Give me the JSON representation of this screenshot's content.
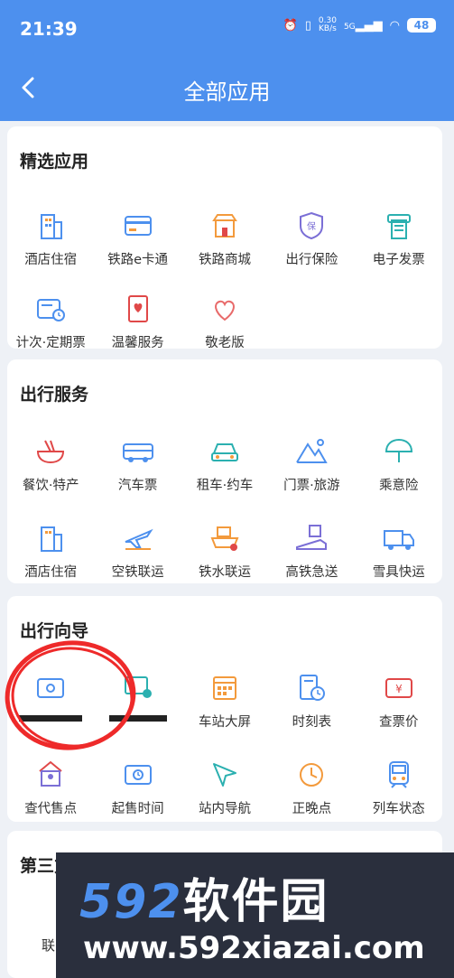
{
  "status": {
    "time": "21:39",
    "speed_top": "0.30",
    "speed_unit": "KB/s",
    "net": "5G",
    "battery": "48"
  },
  "nav": {
    "title": "全部应用"
  },
  "sections": [
    {
      "title": "精选应用",
      "items": [
        "酒店住宿",
        "铁路e卡通",
        "铁路商城",
        "出行保险",
        "电子发票",
        "计次·定期票",
        "温馨服务",
        "敬老版"
      ]
    },
    {
      "title": "出行服务",
      "items": [
        "餐饮·特产",
        "汽车票",
        "租车·约车",
        "门票·旅游",
        "乘意险",
        "酒店住宿",
        "空铁联运",
        "铁水联运",
        "高铁急送",
        "雪具快运"
      ]
    },
    {
      "title": "出行向导",
      "items": [
        "",
        "",
        "车站大屏",
        "时刻表",
        "查票价",
        "查代售点",
        "起售时间",
        "站内导航",
        "正晚点",
        "列车状态"
      ]
    },
    {
      "title": "第三方服务",
      "items": [
        "联"
      ]
    }
  ],
  "ad": {
    "brand_num": "592",
    "brand_cn": "软件园",
    "url": "www.592xiazai.com"
  },
  "colors": {
    "primary": "#4d90ee",
    "accent": "#f39a3c",
    "danger": "#e04848"
  }
}
